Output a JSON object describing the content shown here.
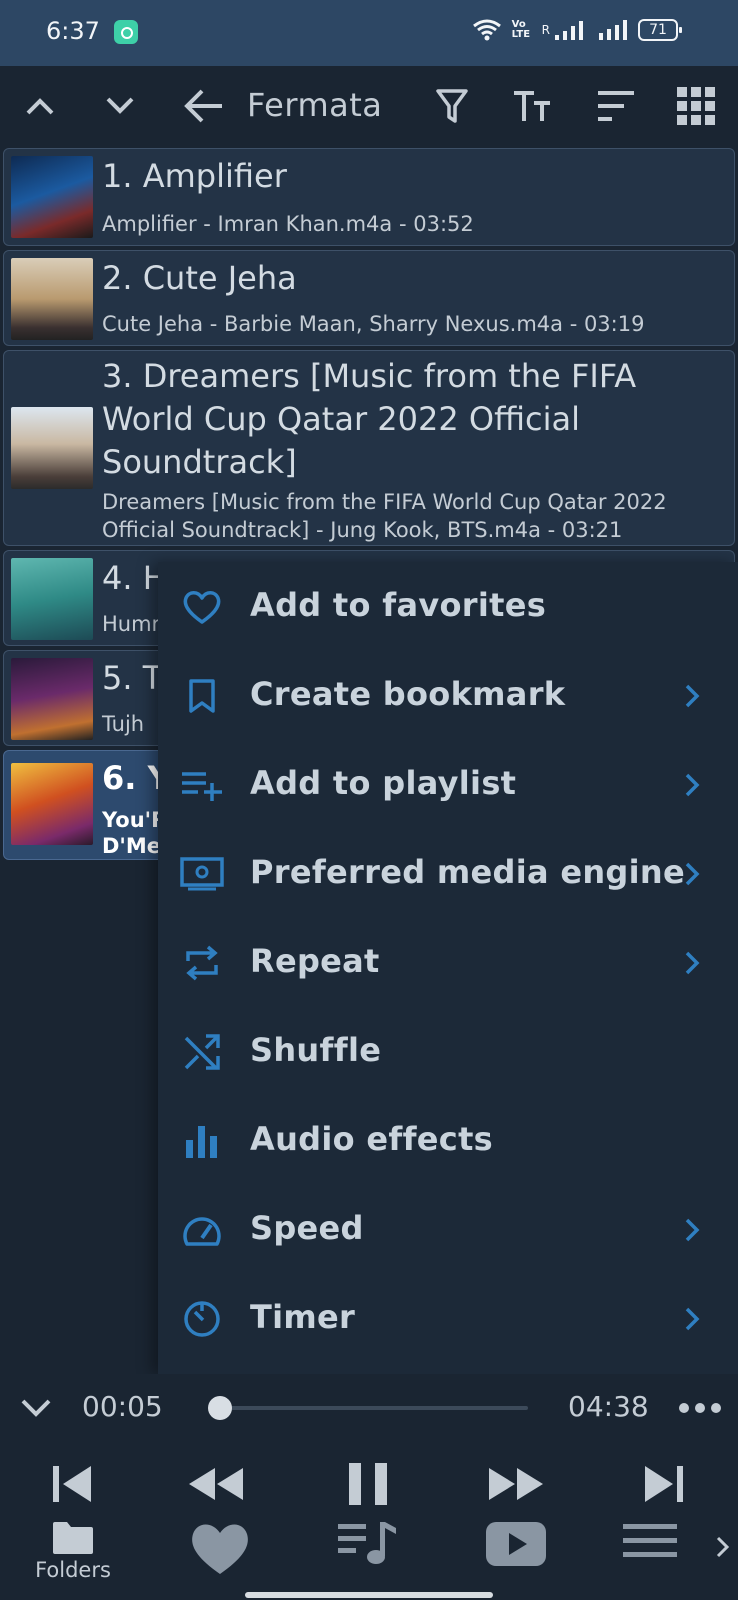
{
  "status_bar": {
    "time": "6:37",
    "volte": "Vo LTE",
    "sim_r": "R",
    "battery": "71"
  },
  "toolbar": {
    "title": "Fermata"
  },
  "tracks": [
    {
      "title": "1. Amplifier",
      "subtitle": "Amplifier - Imran Khan.m4a - 03:52"
    },
    {
      "title": "2. Cute Jeha",
      "subtitle": "Cute Jeha - Barbie Maan, Sharry Nexus.m4a - 03:19"
    },
    {
      "title_lines": [
        "3. Dreamers [Music from the FIFA",
        "World Cup Qatar 2022 Official",
        "Soundtrack]"
      ],
      "subtitle_lines": [
        "Dreamers [Music from the FIFA World Cup Qatar 2022",
        "Official Soundtrack] - Jung Kook, BTS.m4a - 03:21"
      ]
    },
    {
      "title": "4. H",
      "subtitle": "Humr"
    },
    {
      "title": "5. T",
      "subtitle": "Tujh"
    },
    {
      "title": "6. Y",
      "subtitle_lines": [
        "You'R",
        "D'Me"
      ]
    }
  ],
  "menu": {
    "items": [
      {
        "label": "Add to favorites",
        "icon": "heart-outline-icon"
      },
      {
        "label": "Create bookmark",
        "icon": "bookmark-icon"
      },
      {
        "label": "Add to playlist",
        "icon": "playlist-add-icon"
      },
      {
        "label": "Preferred media engine",
        "icon": "media-engine-icon"
      },
      {
        "label": "Repeat",
        "icon": "repeat-icon"
      },
      {
        "label": "Shuffle",
        "icon": "shuffle-icon"
      },
      {
        "label": "Audio effects",
        "icon": "equalizer-icon"
      },
      {
        "label": "Speed",
        "icon": "speedometer-icon"
      },
      {
        "label": "Timer",
        "icon": "timer-icon"
      }
    ]
  },
  "player": {
    "elapsed": "00:05",
    "duration": "04:38",
    "progress": 0.019
  },
  "bottom_nav": {
    "folders_label": "Folders"
  },
  "colors": {
    "accent": "#2f7fc1",
    "background": "#1a2532",
    "status_bar": "#2d4764",
    "playing_row": "#2d4a6e"
  }
}
